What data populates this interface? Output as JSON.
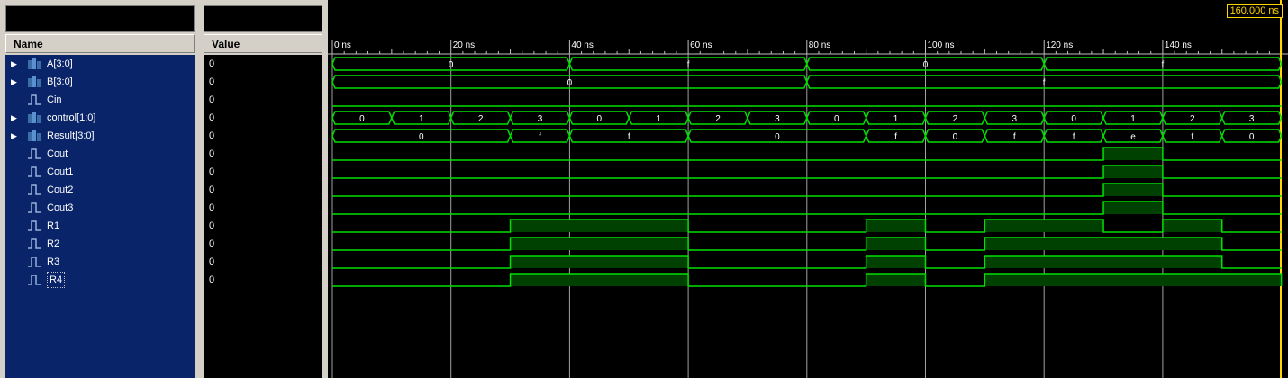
{
  "names_panel": {
    "header": "Name"
  },
  "values_panel": {
    "header": "Value"
  },
  "cursor": {
    "label": "160.000 ns"
  },
  "signals": [
    {
      "name": "A[3:0]",
      "value": "0",
      "expandable": true,
      "kind": "bus"
    },
    {
      "name": "B[3:0]",
      "value": "0",
      "expandable": true,
      "kind": "bus"
    },
    {
      "name": "Cin",
      "value": "0",
      "expandable": false,
      "kind": "bit"
    },
    {
      "name": "control[1:0]",
      "value": "0",
      "expandable": true,
      "kind": "bus"
    },
    {
      "name": "Result[3:0]",
      "value": "0",
      "expandable": true,
      "kind": "bus"
    },
    {
      "name": "Cout",
      "value": "0",
      "expandable": false,
      "kind": "bit"
    },
    {
      "name": "Cout1",
      "value": "0",
      "expandable": false,
      "kind": "bit"
    },
    {
      "name": "Cout2",
      "value": "0",
      "expandable": false,
      "kind": "bit"
    },
    {
      "name": "Cout3",
      "value": "0",
      "expandable": false,
      "kind": "bit"
    },
    {
      "name": "R1",
      "value": "0",
      "expandable": false,
      "kind": "bit"
    },
    {
      "name": "R2",
      "value": "0",
      "expandable": false,
      "kind": "bit"
    },
    {
      "name": "R3",
      "value": "0",
      "expandable": false,
      "kind": "bit"
    },
    {
      "name": "R4",
      "value": "0",
      "expandable": false,
      "kind": "bit",
      "selected": true
    }
  ],
  "time_axis": {
    "unit": "ns",
    "tick_labels": [
      "0 ns",
      "20 ns",
      "40 ns",
      "60 ns",
      "80 ns",
      "100 ns",
      "120 ns",
      "140 ns"
    ],
    "major_ticks": [
      0,
      20,
      40,
      60,
      80,
      100,
      120,
      140
    ],
    "range": [
      0,
      160
    ]
  },
  "colors": {
    "waveform": "#00e000",
    "waveform_fill": "#004000",
    "grid": "#a0a0a0",
    "cursor": "#ffd400",
    "selection_bg": "#0a246a"
  },
  "waveforms": {
    "A[3:0]": {
      "segments": [
        [
          0,
          40,
          "0"
        ],
        [
          40,
          80,
          "f"
        ],
        [
          80,
          120,
          "0"
        ],
        [
          120,
          160,
          "f"
        ]
      ]
    },
    "B[3:0]": {
      "segments": [
        [
          0,
          80,
          "0"
        ],
        [
          80,
          160,
          "f"
        ]
      ]
    },
    "control[1:0]": {
      "segments": [
        [
          0,
          10,
          "0"
        ],
        [
          10,
          20,
          "1"
        ],
        [
          20,
          30,
          "2"
        ],
        [
          30,
          40,
          "3"
        ],
        [
          40,
          50,
          "0"
        ],
        [
          50,
          60,
          "1"
        ],
        [
          60,
          70,
          "2"
        ],
        [
          70,
          80,
          "3"
        ],
        [
          80,
          90,
          "0"
        ],
        [
          90,
          100,
          "1"
        ],
        [
          100,
          110,
          "2"
        ],
        [
          110,
          120,
          "3"
        ],
        [
          120,
          130,
          "0"
        ],
        [
          130,
          140,
          "1"
        ],
        [
          140,
          150,
          "2"
        ],
        [
          150,
          160,
          "3"
        ]
      ]
    },
    "Result[3:0]": {
      "segments": [
        [
          0,
          30,
          "0"
        ],
        [
          30,
          40,
          "f"
        ],
        [
          40,
          60,
          "f"
        ],
        [
          60,
          90,
          "0"
        ],
        [
          90,
          100,
          "f"
        ],
        [
          100,
          110,
          "0"
        ],
        [
          110,
          120,
          "f"
        ],
        [
          120,
          130,
          "f"
        ],
        [
          130,
          140,
          "e"
        ],
        [
          140,
          150,
          "f"
        ],
        [
          150,
          160,
          "0"
        ]
      ]
    },
    "Cin": {
      "high": []
    },
    "Cout": {
      "high": [
        [
          130,
          140
        ]
      ]
    },
    "Cout1": {
      "high": [
        [
          130,
          140
        ]
      ]
    },
    "Cout2": {
      "high": [
        [
          130,
          140
        ]
      ]
    },
    "Cout3": {
      "high": [
        [
          130,
          140
        ]
      ]
    },
    "R1": {
      "high": [
        [
          30,
          60
        ],
        [
          90,
          100
        ],
        [
          110,
          130
        ],
        [
          140,
          150
        ]
      ]
    },
    "R2": {
      "high": [
        [
          30,
          60
        ],
        [
          90,
          100
        ],
        [
          110,
          150
        ]
      ]
    },
    "R3": {
      "high": [
        [
          30,
          60
        ],
        [
          90,
          100
        ],
        [
          110,
          150
        ]
      ]
    },
    "R4": {
      "high": [
        [
          30,
          60
        ],
        [
          90,
          100
        ],
        [
          110,
          160
        ]
      ]
    }
  }
}
